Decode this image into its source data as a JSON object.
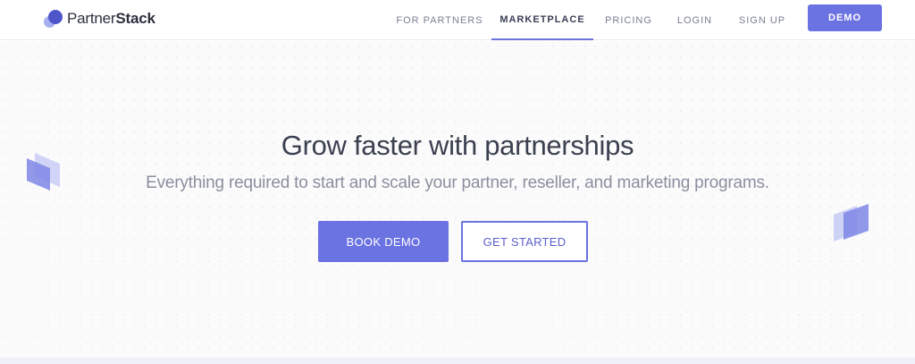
{
  "brand": {
    "name_light": "Partner",
    "name_bold": "Stack"
  },
  "nav": {
    "items": [
      {
        "label": "FOR PARTNERS",
        "active": false
      },
      {
        "label": "MARKETPLACE",
        "active": true
      },
      {
        "label": "PRICING",
        "active": false
      },
      {
        "label": "LOGIN",
        "active": false
      },
      {
        "label": "SIGN UP",
        "active": false
      }
    ],
    "cta_label": "DEMO"
  },
  "hero": {
    "headline": "Grow faster with partnerships",
    "subhead": "Everything required to start and scale your partner, reseller, and marketing programs.",
    "primary_button": "BOOK DEMO",
    "secondary_button": "GET STARTED"
  },
  "colors": {
    "accent": "#6b72e1",
    "logo_dark": "#4d55c9",
    "logo_light": "#a7b0ef",
    "heading": "#3c4150",
    "muted": "#8b8f9e"
  },
  "icons": {
    "logo": "overlapping-circles-logo",
    "decor_left": "stacked-parallelogram-shape",
    "decor_right": "stacked-parallelogram-shape"
  }
}
